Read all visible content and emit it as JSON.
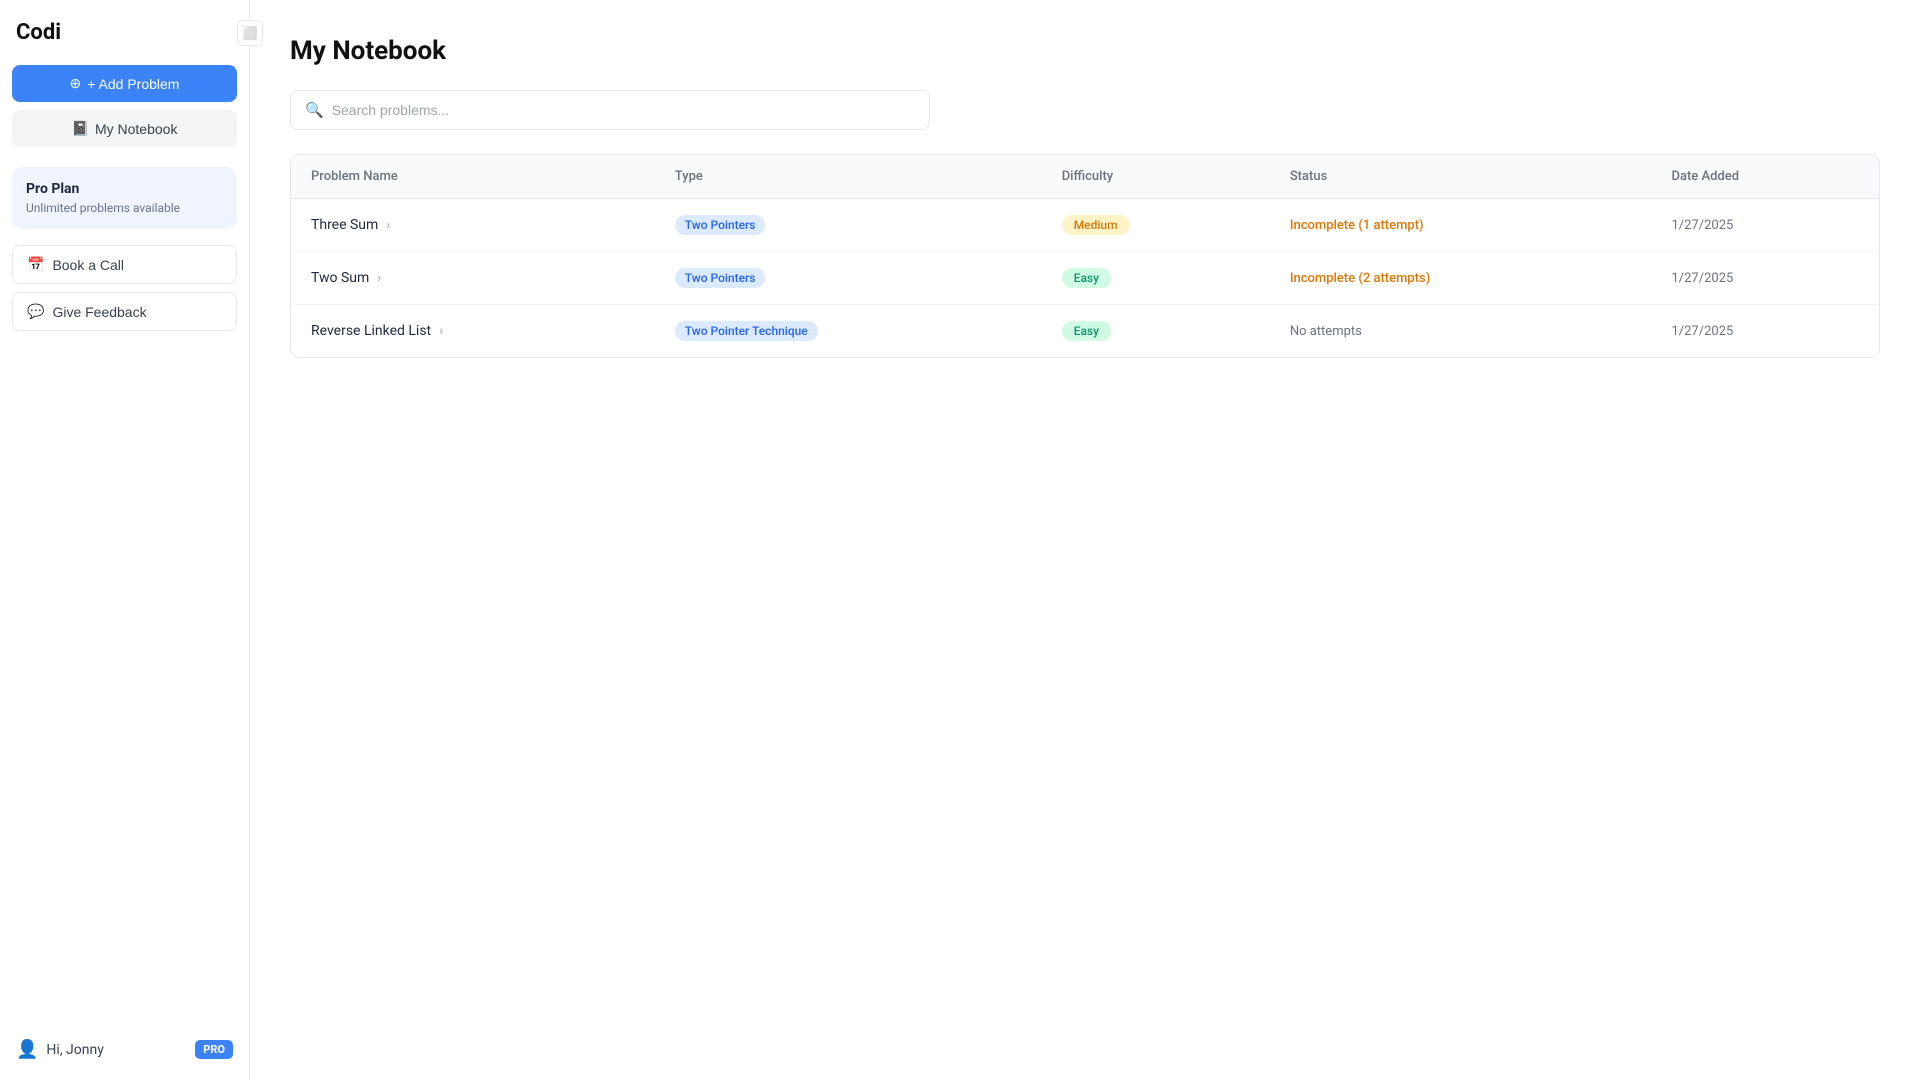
{
  "sidebar": {
    "logo": "Codi",
    "add_problem_label": "+ Add Problem",
    "notebook_label": "My Notebook",
    "notebook_icon": "📓",
    "pro_plan": {
      "title": "Pro Plan",
      "subtitle": "Unlimited problems available"
    },
    "book_call_label": "Book a Call",
    "book_call_icon": "📅",
    "give_feedback_label": "Give Feedback",
    "give_feedback_icon": "💬",
    "user": {
      "greeting": "Hi, Jonny",
      "badge": "PRO"
    }
  },
  "main": {
    "page_title": "My Notebook",
    "search_placeholder": "Search problems...",
    "table": {
      "columns": [
        "Problem Name",
        "Type",
        "Difficulty",
        "Status",
        "Date Added"
      ],
      "rows": [
        {
          "name": "Three Sum",
          "type": "Two Pointers",
          "type_class": "type-two-pointers",
          "difficulty": "Medium",
          "difficulty_class": "difficulty-medium",
          "status": "Incomplete (1 attempt)",
          "status_class": "status-incomplete-orange",
          "date": "1/27/2025"
        },
        {
          "name": "Two Sum",
          "type": "Two Pointers",
          "type_class": "type-two-pointers",
          "difficulty": "Easy",
          "difficulty_class": "difficulty-easy",
          "status": "Incomplete (2 attempts)",
          "status_class": "status-incomplete-orange",
          "date": "1/27/2025"
        },
        {
          "name": "Reverse Linked List",
          "type": "Two Pointer Technique",
          "type_class": "type-two-pointer-technique",
          "difficulty": "Easy",
          "difficulty_class": "difficulty-easy",
          "status": "No attempts",
          "status_class": "status-no-attempts",
          "date": "1/27/2025"
        }
      ]
    }
  }
}
